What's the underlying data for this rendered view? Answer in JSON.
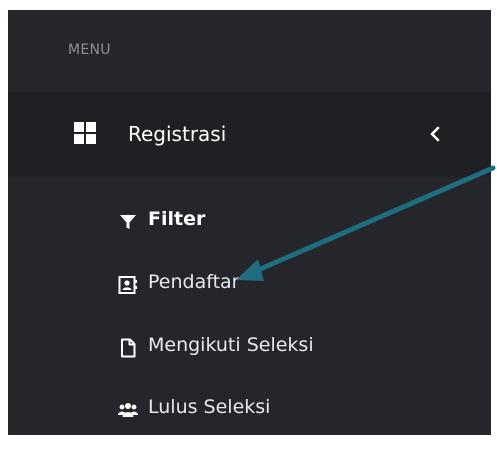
{
  "sidebar": {
    "menu_header": "MENU",
    "parent_item": {
      "label": "Registrasi",
      "icon": "grid-icon",
      "chevron": "chevron-left-icon"
    },
    "submenu": [
      {
        "label": "Filter",
        "icon": "filter-icon"
      },
      {
        "label": "Pendaftar",
        "icon": "id-card-icon"
      },
      {
        "label": "Mengikuti Seleksi",
        "icon": "file-icon"
      },
      {
        "label": "Lulus Seleksi",
        "icon": "users-icon"
      }
    ]
  },
  "annotation": {
    "arrow_color": "#1f6e80"
  },
  "colors": {
    "sidebar_bg": "#24262c",
    "active_item_bg": "#1e2023",
    "text": "#ffffff",
    "muted": "#8b9097"
  }
}
